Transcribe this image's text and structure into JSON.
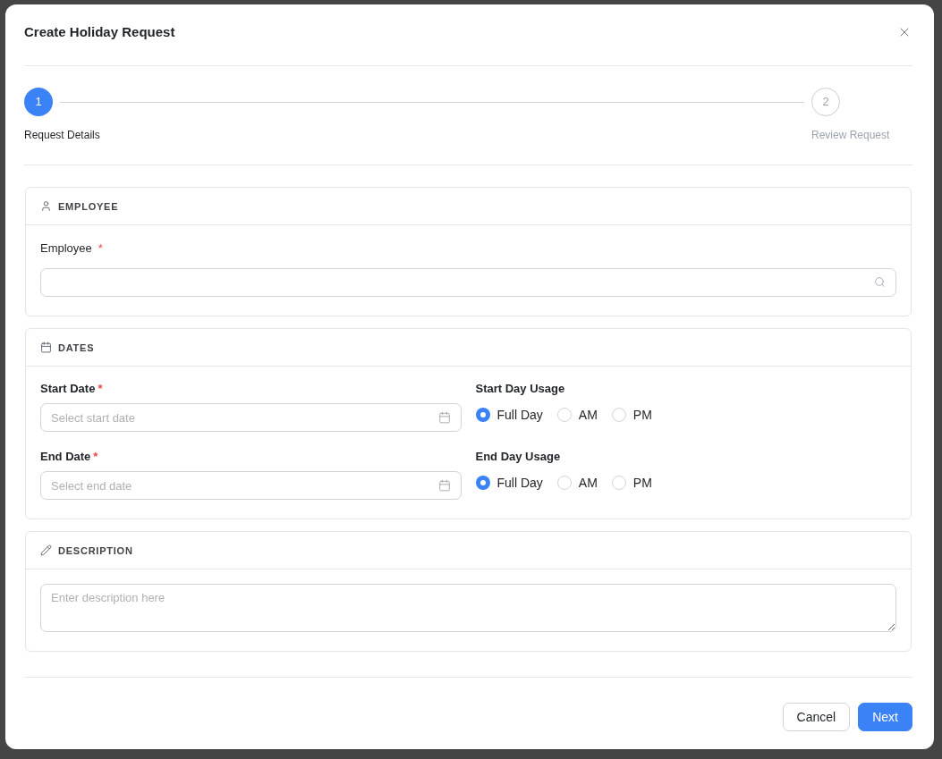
{
  "dialog": {
    "title": "Create Holiday Request"
  },
  "stepper": [
    {
      "number": "1",
      "label": "Request Details",
      "selected": true
    },
    {
      "number": "2",
      "label": "Review Request",
      "selected": false
    }
  ],
  "sections": [
    {
      "kind": "employee",
      "title": "EMPLOYEE",
      "field": {
        "label": "Employee",
        "required_mark": "*"
      }
    },
    {
      "kind": "dates",
      "title": "DATES",
      "rows": [
        {
          "date": {
            "label": "Start Date",
            "required_mark": "*",
            "placeholder": "Select start date"
          },
          "usage": {
            "label": "Start Day Usage",
            "options": [
              {
                "label": "Full Day",
                "selected": true
              },
              {
                "label": "AM",
                "selected": false
              },
              {
                "label": "PM",
                "selected": false
              }
            ]
          }
        },
        {
          "date": {
            "label": "End Date",
            "required_mark": "*",
            "placeholder": "Select end date"
          },
          "usage": {
            "label": "End Day Usage",
            "options": [
              {
                "label": "Full Day",
                "selected": true
              },
              {
                "label": "AM",
                "selected": false
              },
              {
                "label": "PM",
                "selected": false
              }
            ]
          }
        }
      ]
    },
    {
      "kind": "description",
      "title": "DESCRIPTION",
      "placeholder": "Enter description here"
    }
  ],
  "buttons": [
    {
      "label": "Cancel",
      "kind": "secondary"
    },
    {
      "label": "Next",
      "kind": "primary"
    }
  ]
}
